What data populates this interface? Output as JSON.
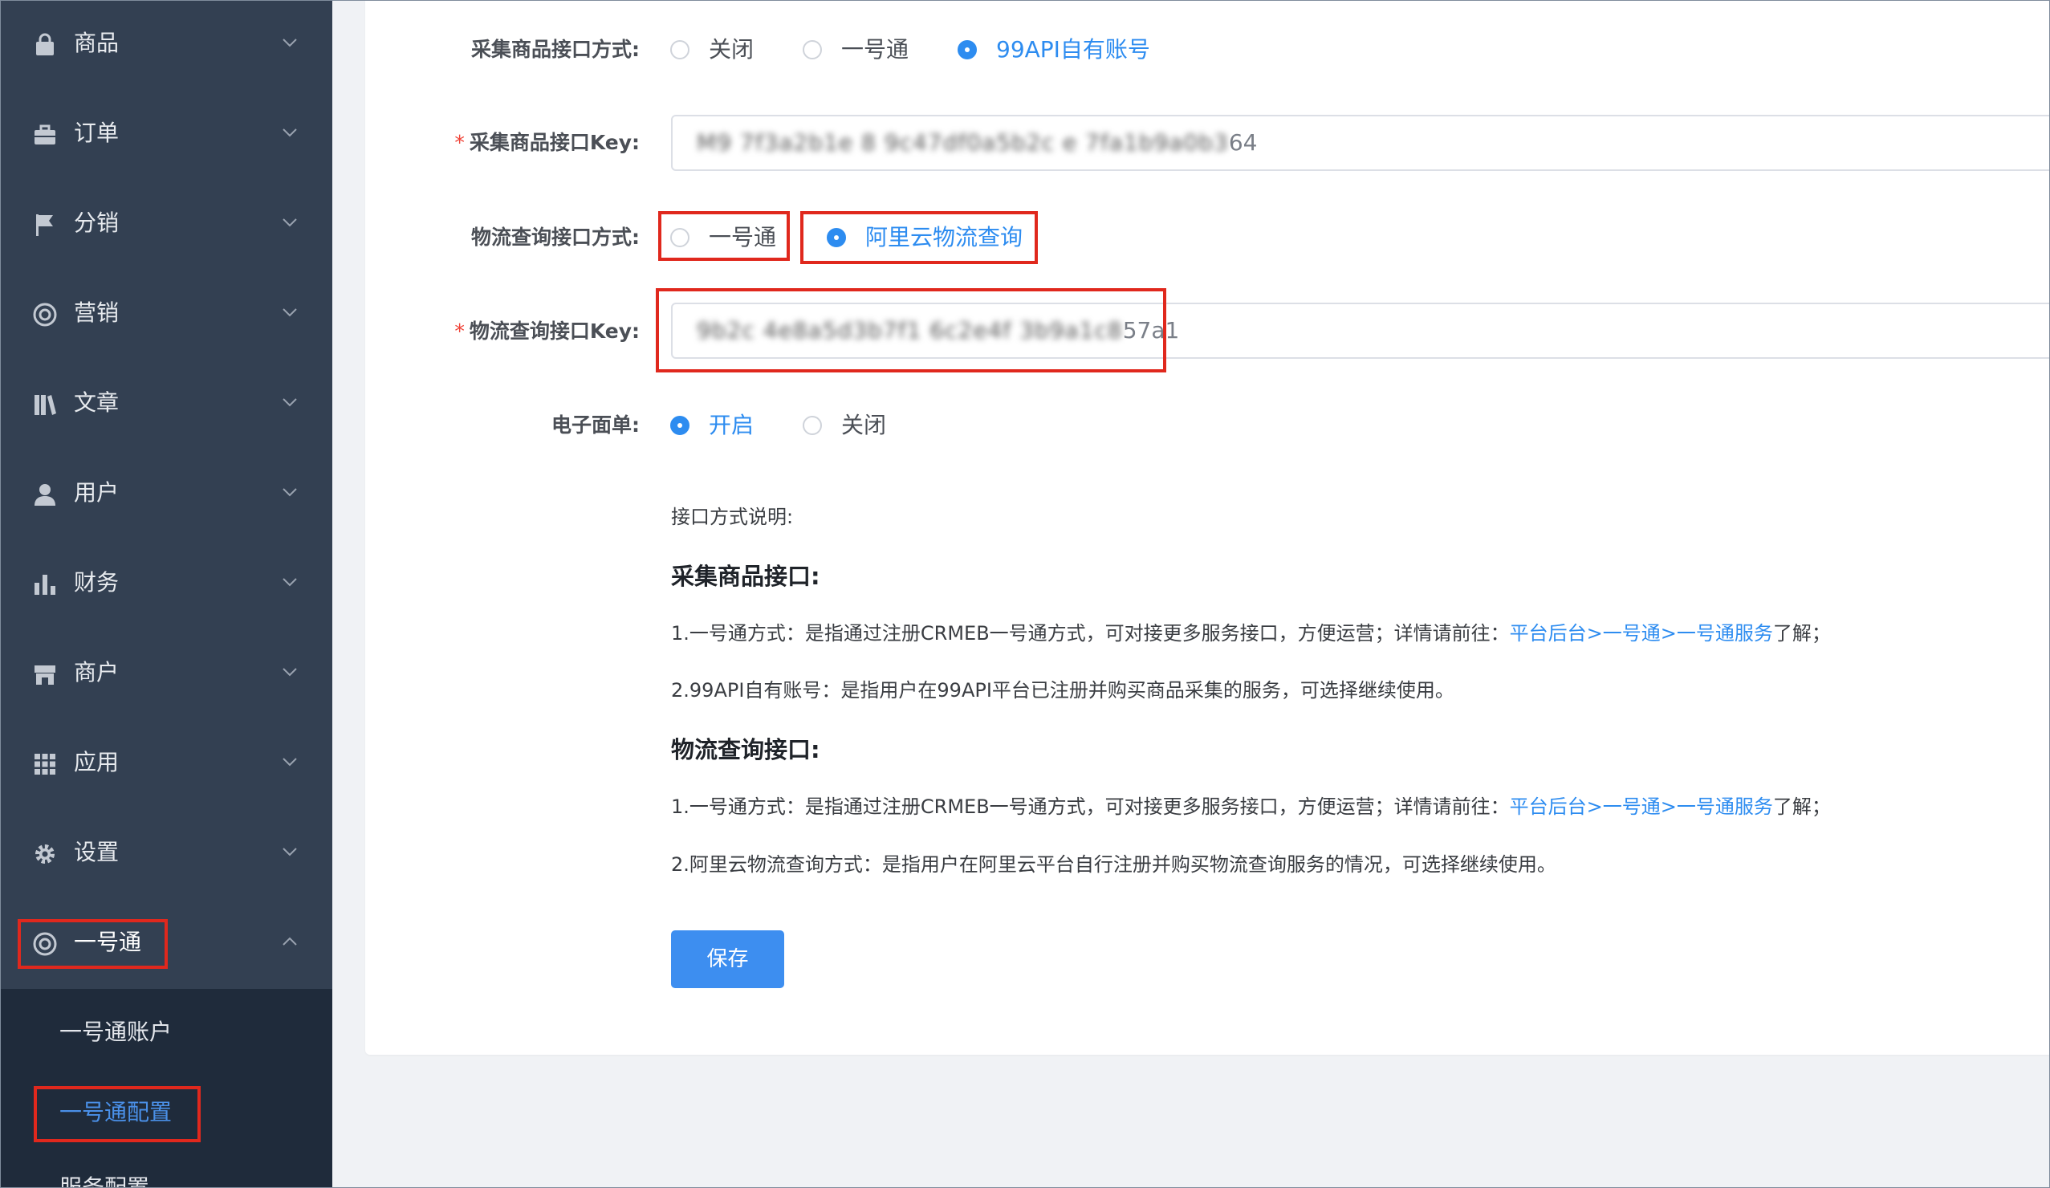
{
  "sidebar": {
    "items": [
      {
        "label": "商品",
        "icon": "bag-icon"
      },
      {
        "label": "订单",
        "icon": "briefcase-icon"
      },
      {
        "label": "分销",
        "icon": "flag-icon"
      },
      {
        "label": "营销",
        "icon": "lifebuoy-icon"
      },
      {
        "label": "文章",
        "icon": "books-icon"
      },
      {
        "label": "用户",
        "icon": "user-icon"
      },
      {
        "label": "财务",
        "icon": "bar-chart-icon"
      },
      {
        "label": "商户",
        "icon": "store-icon"
      },
      {
        "label": "应用",
        "icon": "grid-icon"
      },
      {
        "label": "设置",
        "icon": "gear-icon"
      },
      {
        "label": "一号通",
        "icon": "lifebuoy-icon"
      }
    ],
    "submenu": [
      {
        "label": "一号通账户"
      },
      {
        "label": "一号通配置",
        "active": true
      },
      {
        "label": "服务配置"
      }
    ]
  },
  "form": {
    "collect_method": {
      "label": "采集商品接口方式:",
      "options": [
        "关闭",
        "一号通",
        "99API自有账号"
      ],
      "selected": "99API自有账号"
    },
    "collect_key": {
      "label": "采集商品接口Key:",
      "required": true,
      "masked": "M9 7f3a2b1e 8 9c47df0a5b2c e 7fa1b9a0b3",
      "suffix": "64"
    },
    "logistics_method": {
      "label": "物流查询接口方式:",
      "options": [
        "一号通",
        "阿里云物流查询"
      ],
      "selected": "阿里云物流查询"
    },
    "logistics_key": {
      "label": "物流查询接口Key:",
      "required": true,
      "masked": "9b2c 4e8a5d3b7f1 6c2e4f 3b9a1c8",
      "suffix": "57a1"
    },
    "e_waybill": {
      "label": "电子面单:",
      "options": [
        "开启",
        "关闭"
      ],
      "selected": "开启"
    }
  },
  "notes": {
    "title": "接口方式说明:",
    "collect_heading": "采集商品接口:",
    "collect_1_prefix": "1.一号通方式：是指通过注册CRMEB一号通方式，可对接更多服务接口，方便运营；详情请前往：",
    "collect_1_link": "平台后台>一号通>一号通服务",
    "collect_1_suffix": "了解；",
    "collect_2": "2.99API自有账号：是指用户在99API平台已注册并购买商品采集的服务，可选择继续使用。",
    "logistics_heading": "物流查询接口:",
    "logistics_1_prefix": "1.一号通方式：是指通过注册CRMEB一号通方式，可对接更多服务接口，方便运营；详情请前往：",
    "logistics_1_link": "平台后台>一号通>一号通服务",
    "logistics_1_suffix": "了解；",
    "logistics_2": "2.阿里云物流查询方式：是指用户在阿里云平台自行注册并购买物流查询服务的情况，可选择继续使用。"
  },
  "save_button": "保存",
  "colors": {
    "sidebar_bg": "#334052",
    "submenu_bg": "#1f2b3b",
    "accent": "#2d8cf0",
    "highlight": "#e0281d"
  }
}
